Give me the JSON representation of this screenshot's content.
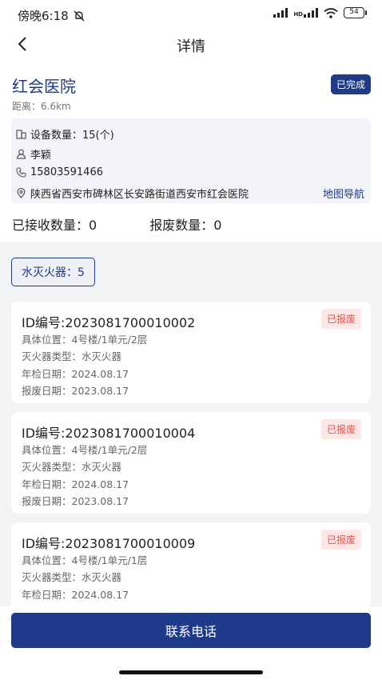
{
  "status_bar": {
    "time": "傍晚6:18",
    "network": "HD",
    "battery": "54"
  },
  "nav": {
    "title": "详情"
  },
  "hospital": {
    "name": "红会医院",
    "status": "已完成",
    "distance": "距离：6.6km",
    "device_count": "设备数量：15(个)",
    "contact_name": "李颖",
    "phone": "15803591466",
    "address": "陕西省西安市碑林区长安路街道西安市红会医院",
    "map_link": "地图导航"
  },
  "counts": {
    "received": "已接收数量：0",
    "scrapped": "报废数量：0"
  },
  "filter": {
    "label": "水灭火器：5"
  },
  "cards": [
    {
      "id": "ID编号:2023081700010002",
      "badge": "已报废",
      "location": "具体位置：4号楼/1单元/2层",
      "type": "灭火器类型：水灭火器",
      "inspect": "年检日期：2024.08.17",
      "scrap": "报废日期：2023.08.17"
    },
    {
      "id": "ID编号:2023081700010004",
      "badge": "已报废",
      "location": "具体位置：4号楼/1单元/2层",
      "type": "灭火器类型：水灭火器",
      "inspect": "年检日期：2024.08.17",
      "scrap": "报废日期：2023.08.17"
    },
    {
      "id": "ID编号:2023081700010009",
      "badge": "已报废",
      "location": "具体位置：4号楼/1单元/1层",
      "type": "灭火器类型：水灭火器",
      "inspect": "年检日期：2024.08.17",
      "scrap": ""
    }
  ],
  "footer": {
    "button": "联系电话"
  },
  "icons": {
    "back": "chevron-left-icon",
    "silent": "bell-off-icon",
    "signal": "signal-icon",
    "wifi": "wifi-icon",
    "battery": "battery-icon",
    "device": "device-icon",
    "person": "person-icon",
    "phone": "phone-icon",
    "location": "location-pin-icon"
  },
  "colors": {
    "primary": "#1e3a8a",
    "scrap_badge_text": "#e5534b",
    "scrap_badge_bg": "#fde7e6"
  }
}
